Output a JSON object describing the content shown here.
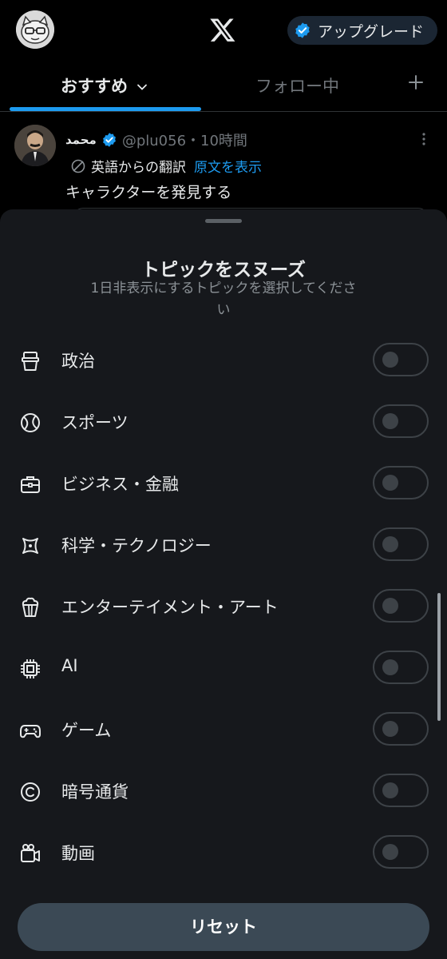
{
  "header": {
    "upgrade_label": "アップグレード"
  },
  "tabs": {
    "for_you": "おすすめ",
    "following": "フォロー中"
  },
  "tweet": {
    "name": "محمد",
    "handle_time": "@plu056・10時間",
    "translated_from": "英語からの翻訳",
    "show_original": "原文を表示",
    "text": "キャラクターを発見する"
  },
  "sheet": {
    "title": "トピックをスヌーズ",
    "subtitle": "1日非表示にするトピックを選択してください",
    "topics": [
      {
        "label": "政治",
        "icon": "politics-icon",
        "on": false
      },
      {
        "label": "スポーツ",
        "icon": "sports-ball-icon",
        "on": false
      },
      {
        "label": "ビジネス・金融",
        "icon": "briefcase-icon",
        "on": false
      },
      {
        "label": "科学・テクノロジー",
        "icon": "atom-icon",
        "on": false
      },
      {
        "label": "エンターテイメント・アート",
        "icon": "popcorn-icon",
        "on": false
      },
      {
        "label": "AI",
        "icon": "chip-icon",
        "on": false
      },
      {
        "label": "ゲーム",
        "icon": "gamepad-icon",
        "on": false
      },
      {
        "label": "暗号通貨",
        "icon": "coin-icon",
        "on": false
      },
      {
        "label": "動画",
        "icon": "video-camera-icon",
        "on": false
      }
    ],
    "reset_label": "リセット"
  },
  "colors": {
    "accent": "#1d9bf0",
    "sheet_bg": "#16181c",
    "reset_bg": "#3b4955"
  }
}
